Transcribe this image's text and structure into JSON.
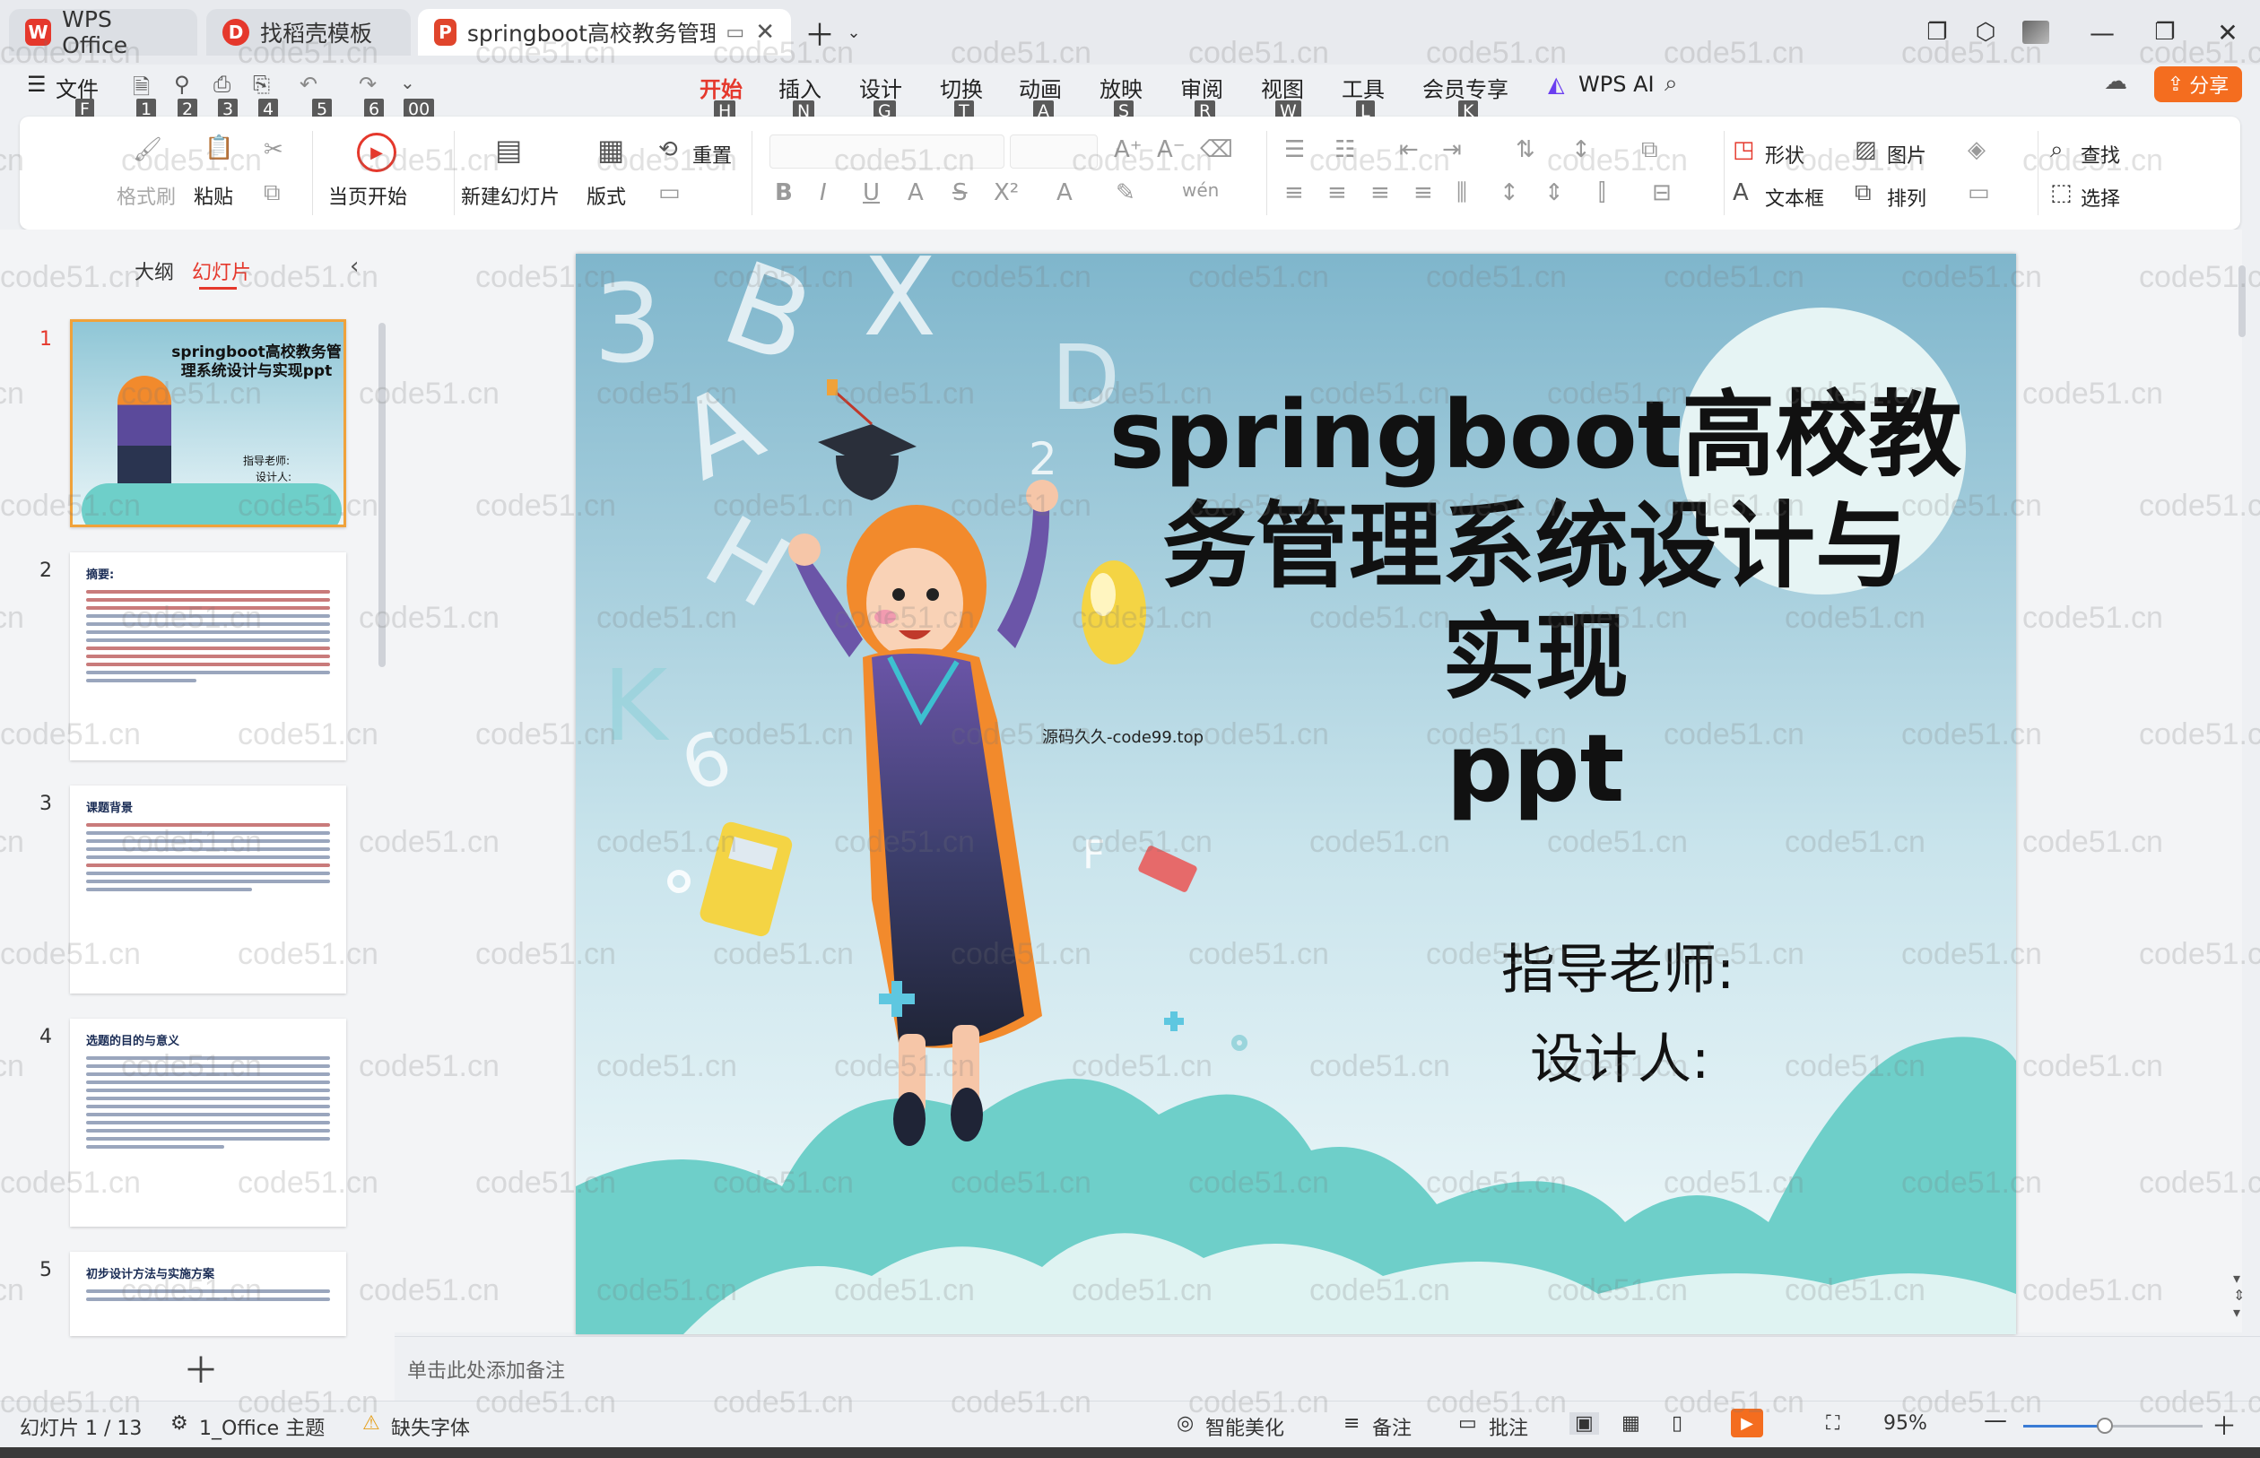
{
  "titlebar": {
    "tabs": [
      {
        "label": "WPS Office",
        "logo": "W"
      },
      {
        "label": "找稻壳模板",
        "logo": "D"
      },
      {
        "label": "springboot高校教务管理系统",
        "logo": "P"
      }
    ]
  },
  "menu": {
    "file_label": "文件",
    "file_key": "F",
    "quick_keys": [
      "1",
      "2",
      "3",
      "4",
      "5",
      "6",
      "00"
    ],
    "tabs": [
      {
        "label": "开始",
        "key": "H"
      },
      {
        "label": "插入",
        "key": "N"
      },
      {
        "label": "设计",
        "key": "G"
      },
      {
        "label": "切换",
        "key": "T"
      },
      {
        "label": "动画",
        "key": "A"
      },
      {
        "label": "放映",
        "key": "S"
      },
      {
        "label": "审阅",
        "key": "R"
      },
      {
        "label": "视图",
        "key": "W"
      },
      {
        "label": "工具",
        "key": "L"
      },
      {
        "label": "会员专享",
        "key": "K"
      }
    ],
    "wps_ai": "WPS AI",
    "share": "分享"
  },
  "ribbon": {
    "format_painter": "格式刷",
    "paste": "粘贴",
    "play_from_current": "当页开始",
    "new_slide": "新建幻灯片",
    "layout": "版式",
    "reset": "重置",
    "shape": "形状",
    "picture": "图片",
    "textbox": "文本框",
    "arrange": "排列",
    "find": "查找",
    "select": "选择"
  },
  "sidepanel": {
    "outline_tab": "大纲",
    "slides_tab": "幻灯片",
    "slides": [
      {
        "num": "1",
        "title": "springboot高校教务管理系统设计与实现ppt",
        "teacher": "指导老师:",
        "designer": "设计人:"
      },
      {
        "num": "2",
        "title": "摘要:"
      },
      {
        "num": "3",
        "title": "课题背景"
      },
      {
        "num": "4",
        "title": "选题的目的与意义"
      },
      {
        "num": "5",
        "title": "初步设计方法与实施方案"
      }
    ]
  },
  "slide": {
    "title_lines": [
      "springboot高校教",
      "务管理系统设计与",
      "实现",
      "ppt"
    ],
    "teacher": "指导老师:",
    "designer": "设计人:",
    "source_note": "源码久久-code99.top",
    "doodles": [
      "3",
      "B",
      "X",
      "A",
      "D",
      "2",
      "H",
      "K",
      "6",
      "F"
    ]
  },
  "notes": {
    "placeholder": "单击此处添加备注"
  },
  "status": {
    "slide_counter": "幻灯片 1 / 13",
    "theme": "1_Office 主题",
    "missing_font": "缺失字体",
    "beautify": "智能美化",
    "notes": "备注",
    "comments": "批注",
    "zoom": "95%"
  },
  "watermark": "code51.cn",
  "colors": {
    "accent_red": "#e5382c",
    "share_orange": "#f46d1f",
    "slide_sky": "#8fc6d6",
    "cloud": "#6ecfc9"
  }
}
